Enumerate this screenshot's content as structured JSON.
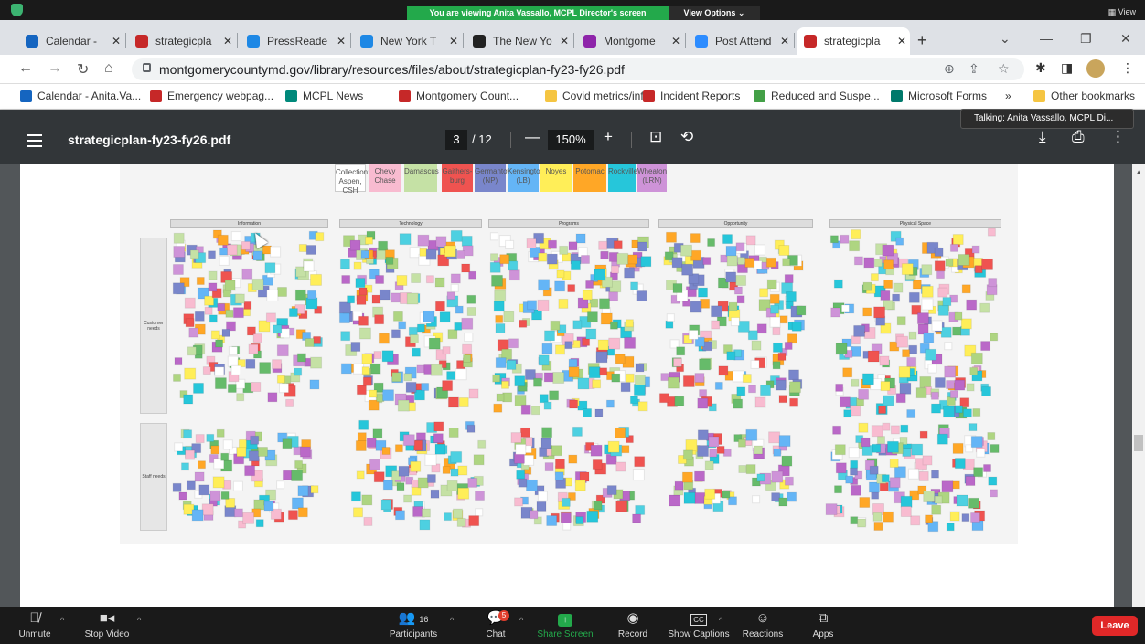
{
  "zoom": {
    "viewing_banner": "You are viewing Anita Vassallo, MCPL Director's screen",
    "view_options": "View Options ⌄",
    "view_right": "View",
    "talking_tooltip": "Talking: Anita Vassallo, MCPL Di...",
    "toolbar": {
      "unmute": "Unmute",
      "stop_video": "Stop Video",
      "participants": "Participants",
      "participants_count": "16",
      "chat": "Chat",
      "chat_badge": "5",
      "share_screen": "Share Screen",
      "record": "Record",
      "show_captions": "Show Captions",
      "reactions": "Reactions",
      "apps": "Apps",
      "leave": "Leave"
    },
    "colors": {
      "share": "#23a94b",
      "leave": "#e02828"
    }
  },
  "browser": {
    "tabs": [
      {
        "label": "Calendar -  ",
        "color": "#1565c0"
      },
      {
        "label": "strategicpla",
        "color": "#c62828"
      },
      {
        "label": "PressReade",
        "color": "#1e88e5"
      },
      {
        "label": "New York T",
        "color": "#1e88e5"
      },
      {
        "label": "The New Yo",
        "color": "#222222"
      },
      {
        "label": "Montgome",
        "color": "#8e24aa"
      },
      {
        "label": "Post Attend",
        "color": "#2d8cff"
      },
      {
        "label": "strategicpla",
        "color": "#c62828"
      }
    ],
    "url": "montgomerycountymd.gov/library/resources/files/about/strategicplan-fy23-fy26.pdf",
    "bookmarks": [
      {
        "label": "Calendar - Anita.Va...",
        "color": "#1565c0"
      },
      {
        "label": "Emergency webpag...",
        "color": "#c62828"
      },
      {
        "label": "MCPL News",
        "color": "#00897b"
      },
      {
        "label": "Montgomery Count...",
        "color": "#c62828"
      },
      {
        "label": "Covid metrics/info",
        "color": "#f5c542"
      },
      {
        "label": "Incident Reports",
        "color": "#c62828"
      },
      {
        "label": "Reduced and Suspe...",
        "color": "#43a047"
      },
      {
        "label": "Microsoft Forms",
        "color": "#00796b"
      },
      {
        "label": "»",
        "color": ""
      },
      {
        "label": "Other bookmarks",
        "color": "#f5c542"
      }
    ]
  },
  "pdf": {
    "title": "strategicplan-fy23-fy26.pdf",
    "page_current": "3",
    "page_total": "/ 12",
    "zoom": "150%",
    "legend": [
      {
        "label": "Collection: Aspen, CSH",
        "color": "#ffffff"
      },
      {
        "label": "Chevy Chase",
        "color": "#f8bbd0"
      },
      {
        "label": "Damascus",
        "color": "#c5e1a5"
      },
      {
        "label": "Gaithers-burg",
        "color": "#ef5350"
      },
      {
        "label": "Germantown (NP)",
        "color": "#7986cb"
      },
      {
        "label": "Kensington (LB)",
        "color": "#64b5f6"
      },
      {
        "label": "Noyes",
        "color": "#ffee58"
      },
      {
        "label": "Potomac",
        "color": "#ffa726"
      },
      {
        "label": "Rockville",
        "color": "#26c6da"
      },
      {
        "label": "Wheaton (LRN)",
        "color": "#ce93d8"
      }
    ],
    "columns": [
      "Information",
      "Technology",
      "Programs",
      "Opportunity",
      "Physical Space"
    ],
    "rows": [
      "Customer needs",
      "Staff needs"
    ]
  }
}
